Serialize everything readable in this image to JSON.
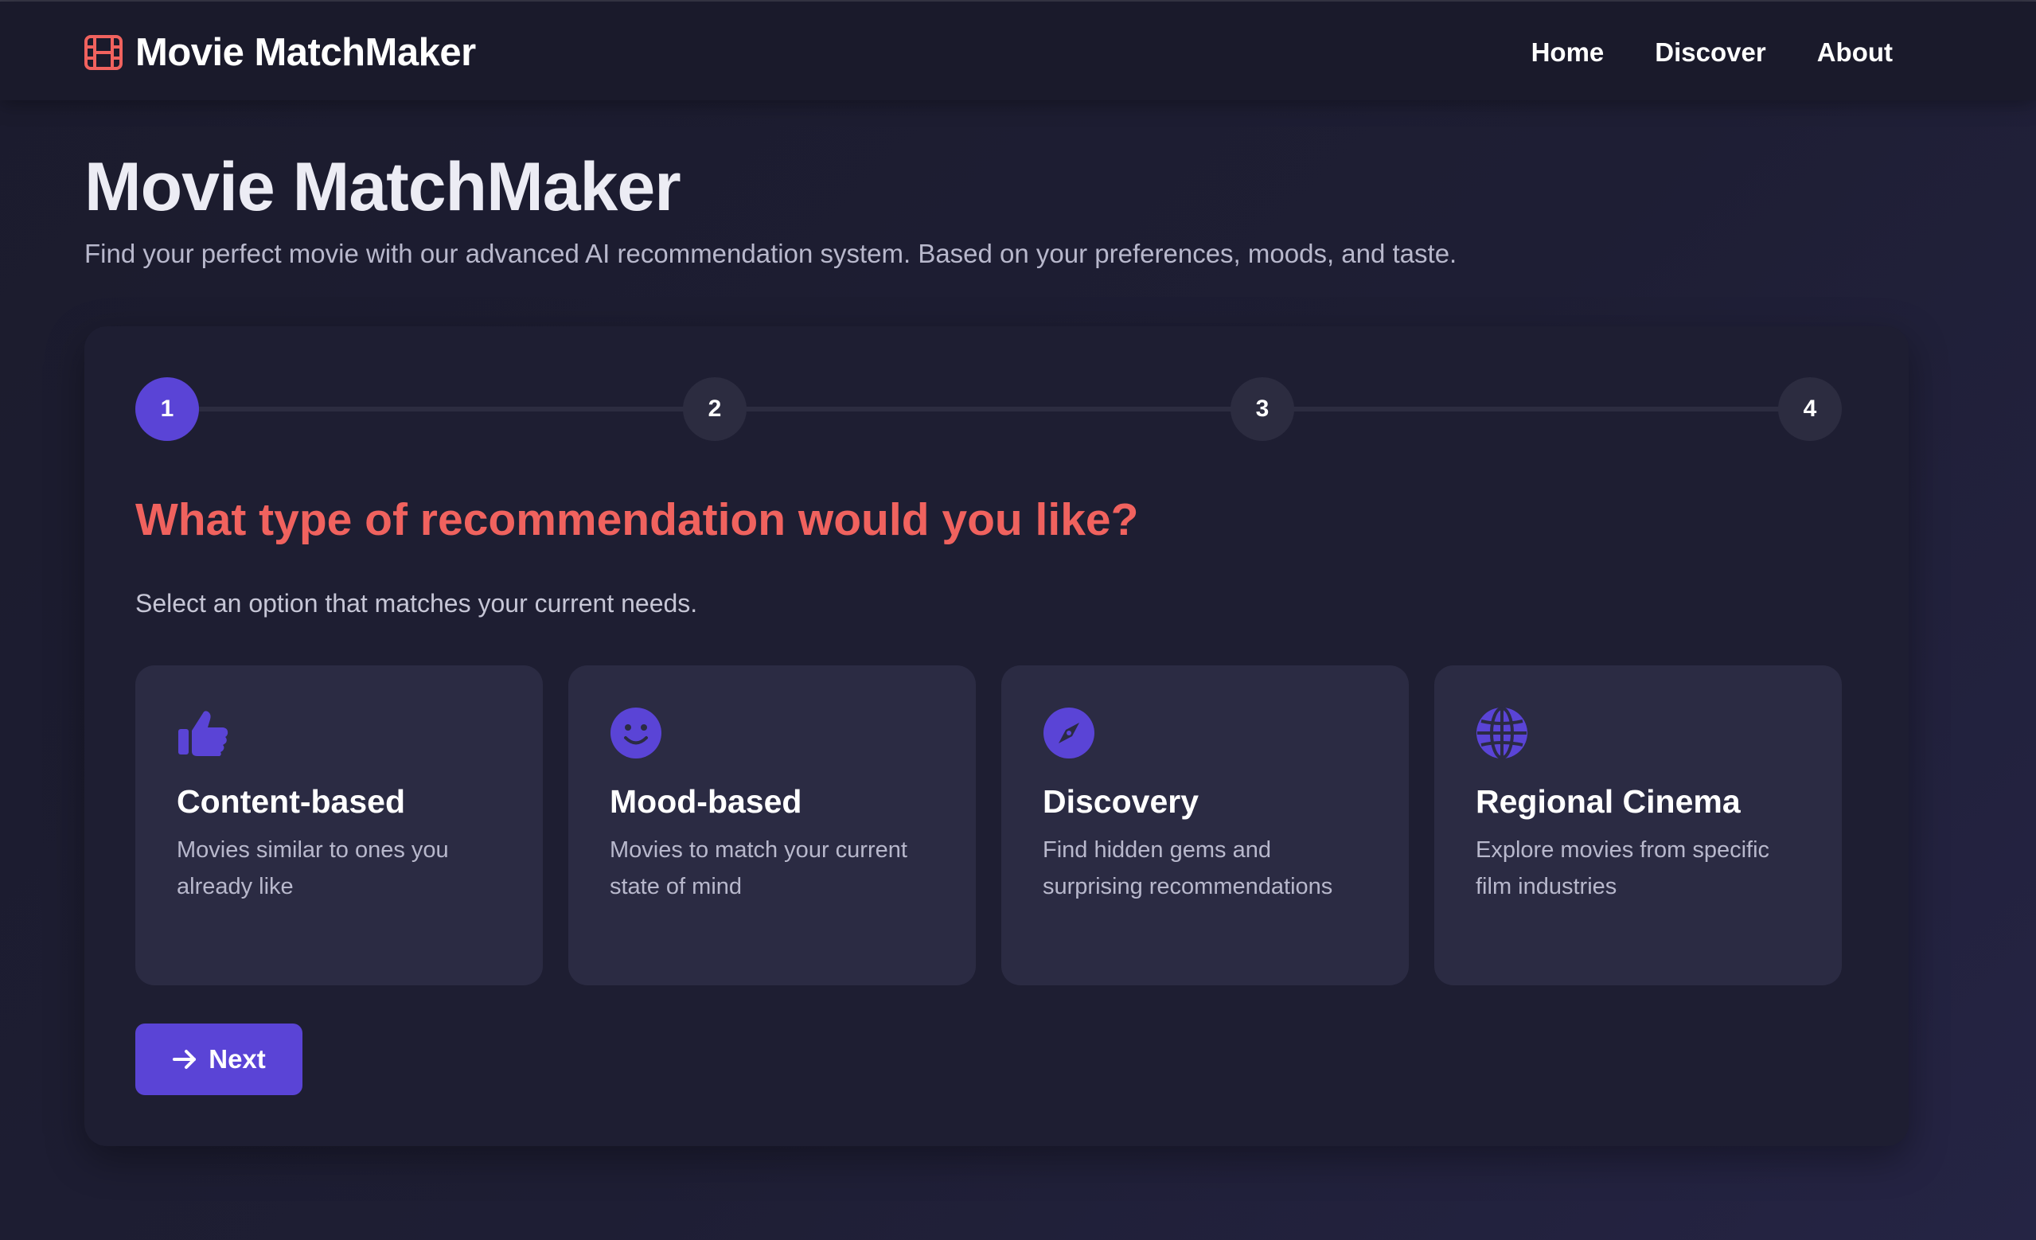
{
  "colors": {
    "accent": "#5a44d6",
    "brand_icon": "#f0625e",
    "question": "#f0625e",
    "background": "#1e1e33",
    "card": "#2b2b43"
  },
  "navbar": {
    "brand_icon": "film-icon",
    "brand_name": "Movie MatchMaker",
    "links": [
      {
        "label": "Home"
      },
      {
        "label": "Discover"
      },
      {
        "label": "About"
      }
    ]
  },
  "hero": {
    "title": "Movie MatchMaker",
    "subtitle": "Find your perfect movie with our advanced AI recommendation system. Based on your preferences, moods, and taste."
  },
  "stepper": {
    "current_step": 1,
    "steps": [
      "1",
      "2",
      "3",
      "4"
    ]
  },
  "question": {
    "title": "What type of recommendation would you like?",
    "instruction": "Select an option that matches your current needs."
  },
  "options": [
    {
      "icon": "thumbs-up-icon",
      "title": "Content-based",
      "description": "Movies similar to ones you already like"
    },
    {
      "icon": "smile-icon",
      "title": "Mood-based",
      "description": "Movies to match your current state of mind"
    },
    {
      "icon": "compass-icon",
      "title": "Discovery",
      "description": "Find hidden gems and surprising recommendations"
    },
    {
      "icon": "globe-icon",
      "title": "Regional Cinema",
      "description": "Explore movies from specific film industries"
    }
  ],
  "next_button": {
    "icon": "arrow-right-icon",
    "label": "Next"
  }
}
